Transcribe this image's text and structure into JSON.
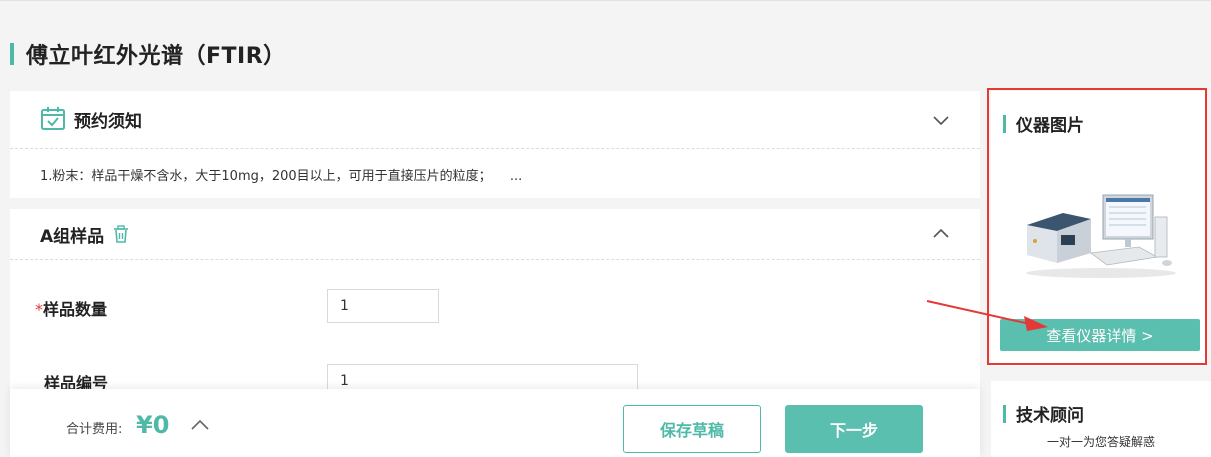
{
  "page": {
    "title": "傅立叶红外光谱（FTIR）"
  },
  "notice": {
    "title": "预约须知",
    "text": "1.粉末：样品干燥不含水，大于10mg，200目以上，可用于直接压片的粒度；",
    "more": "..."
  },
  "sample": {
    "group_title": "A组样品",
    "fields": [
      {
        "label": "样品数量",
        "required_mark": "*",
        "value": "1"
      },
      {
        "label": "样品编号",
        "value": "1"
      }
    ]
  },
  "footer": {
    "total_label": "合计费用:",
    "total_value": "¥0",
    "save_draft": "保存草稿",
    "next": "下一步"
  },
  "sidebar": {
    "instrument": {
      "title": "仪器图片",
      "detail_button": "查看仪器详情 >"
    },
    "tech": {
      "title": "技术顾问",
      "subtitle": "一对一为您答疑解惑"
    }
  },
  "colors": {
    "accent": "#4fb9a8",
    "button": "#5bbfb0",
    "highlight": "#e53935"
  }
}
